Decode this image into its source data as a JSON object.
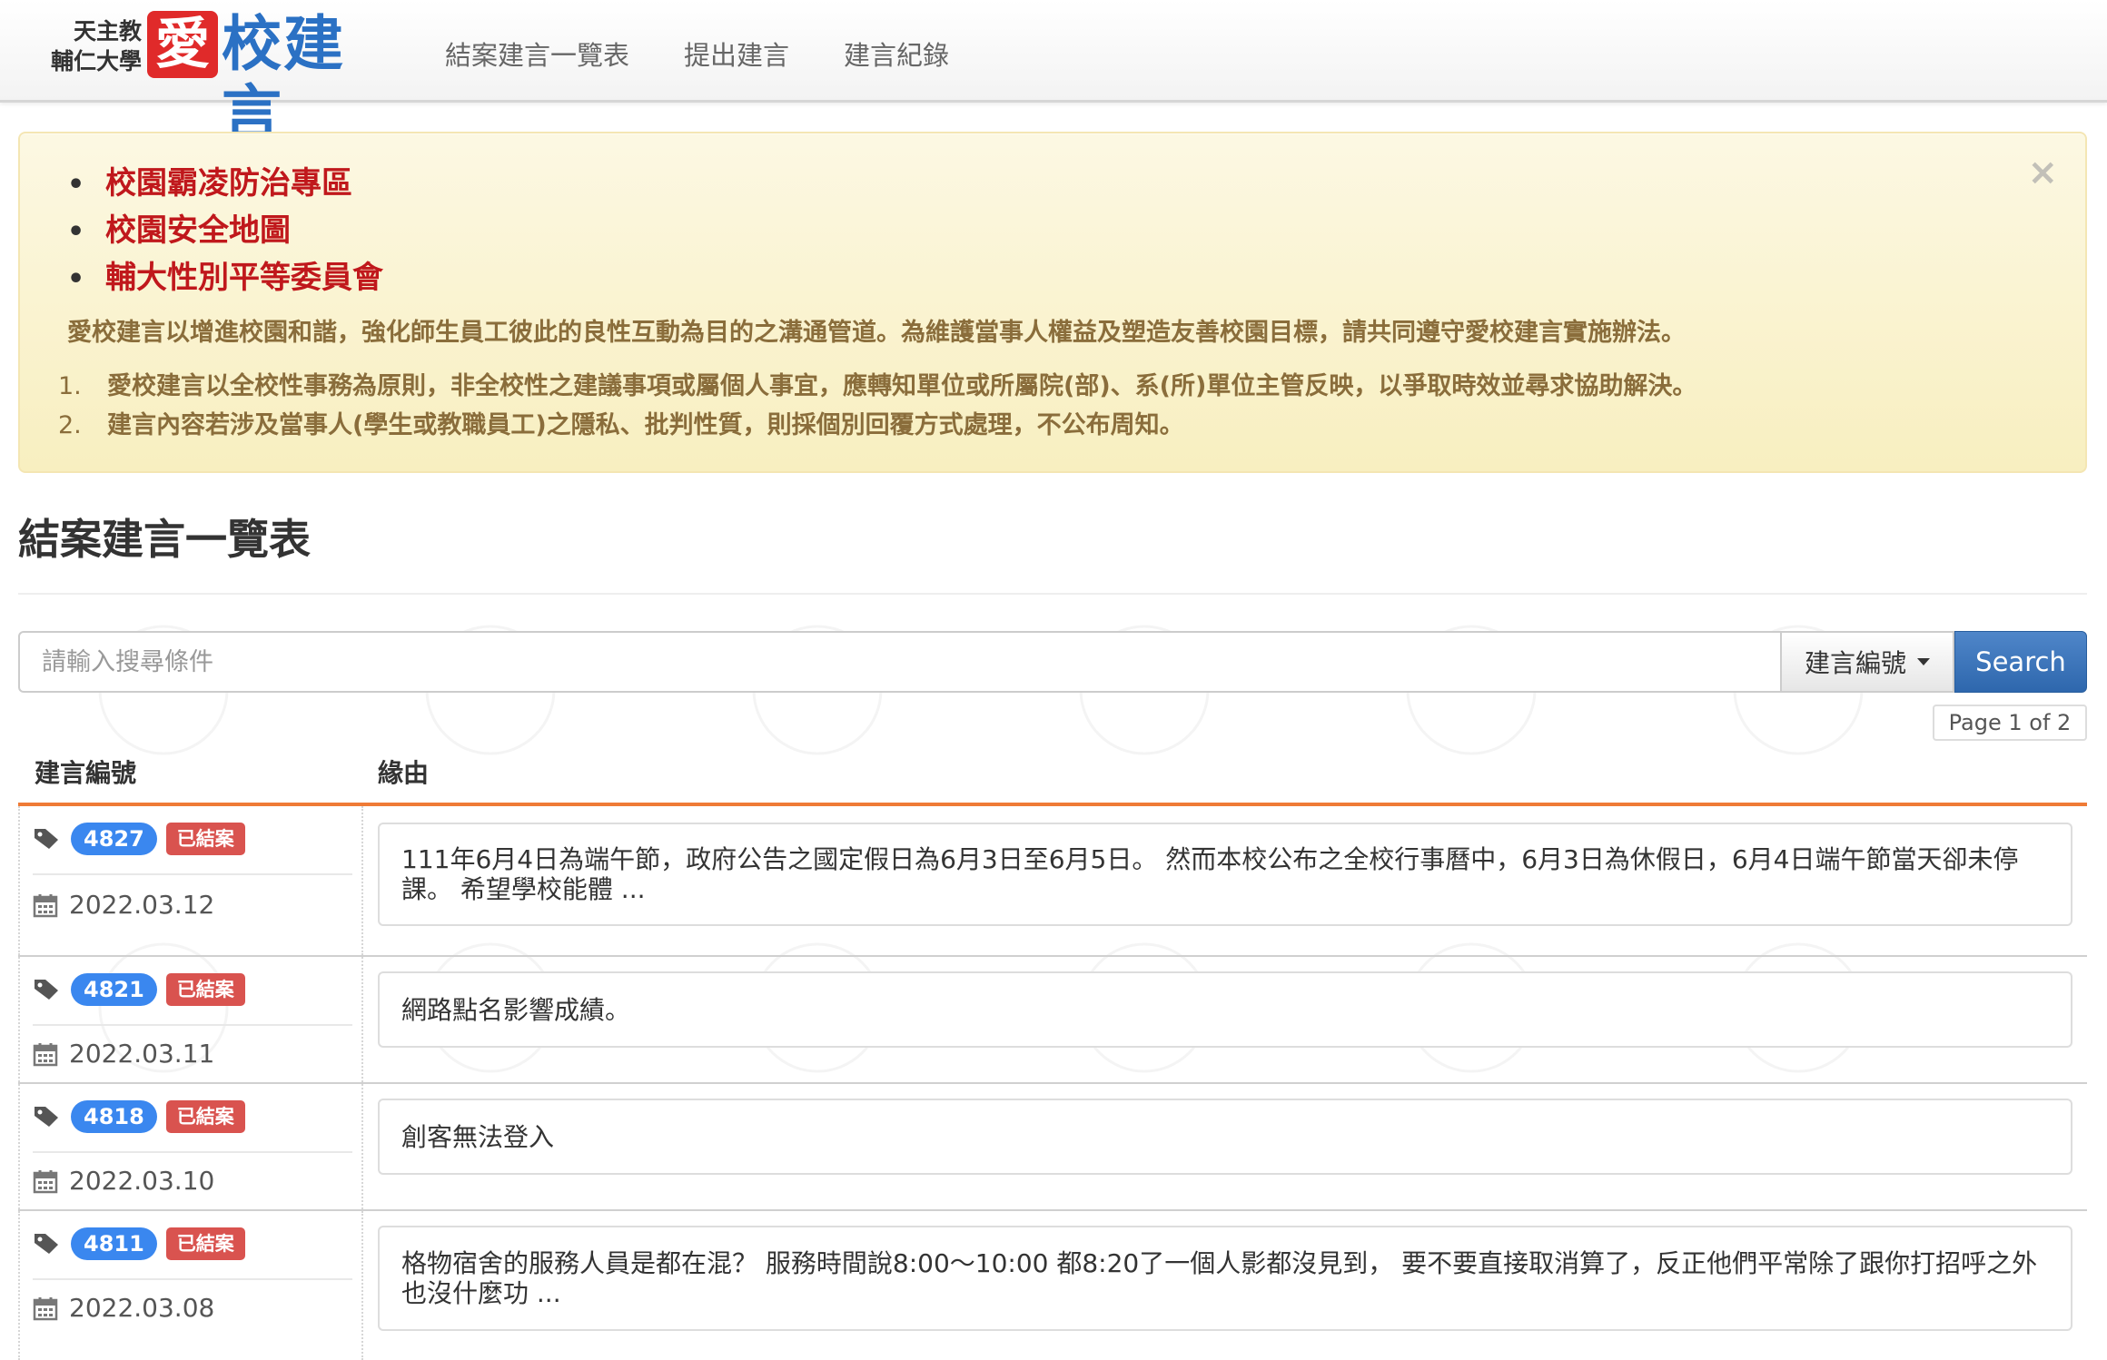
{
  "header": {
    "logo_small_line1": "天主教",
    "logo_small_line2": "輔仁大學",
    "logo_box": "愛",
    "logo_big": "校建言",
    "nav": [
      "結案建言一覽表",
      "提出建言",
      "建言紀錄"
    ]
  },
  "alert": {
    "close": "×",
    "links": [
      "校園霸凌防治專區",
      "校園安全地圖",
      "輔大性別平等委員會"
    ],
    "intro": "愛校建言以增進校園和諧，強化師生員工彼此的良性互動為目的之溝通管道。為維護當事人權益及塑造友善校園目標，請共同遵守愛校建言實施辦法。",
    "rules": [
      {
        "num": "1.",
        "text": "愛校建言以全校性事務為原則，非全校性之建議事項或屬個人事宜，應轉知單位或所屬院(部)、系(所)單位主管反映，以爭取時效並尋求協助解決。"
      },
      {
        "num": "2.",
        "text": "建言內容若涉及當事人(學生或教職員工)之隱私、批判性質，則採個別回覆方式處理，不公布周知。"
      }
    ]
  },
  "page_title": "結案建言一覽表",
  "search": {
    "placeholder": "請輸入搜尋條件",
    "field_select": "建言編號",
    "button": "Search"
  },
  "pagination": "Page 1 of 2",
  "table": {
    "col_id": "建言編號",
    "col_reason": "緣由",
    "rows": [
      {
        "id": "4827",
        "status": "已結案",
        "date": "2022.03.12",
        "reason": "111年6月4日為端午節，政府公告之國定假日為6月3日至6月5日。 然而本校公布之全校行事曆中，6月3日為休假日，6月4日端午節當天卻未停課。 希望學校能體 ..."
      },
      {
        "id": "4821",
        "status": "已結案",
        "date": "2022.03.11",
        "reason": "網路點名影響成績。"
      },
      {
        "id": "4818",
        "status": "已結案",
        "date": "2022.03.10",
        "reason": "創客無法登入"
      },
      {
        "id": "4811",
        "status": "已結案",
        "date": "2022.03.08",
        "reason": "格物宿舍的服務人員是都在混？ 服務時間說8:00～10:00 都8:20了一個人影都沒見到， 要不要直接取消算了，反正他們平常除了跟你打招呼之外也沒什麼功 ..."
      }
    ]
  },
  "colors": {
    "accent_blue": "#2b71c4",
    "alert_link_red": "#c0181c",
    "alert_text": "#8a6d3b",
    "badge_blue": "#3a87ef",
    "badge_red": "#d9534f",
    "table_rule_orange": "#ef7b36"
  },
  "icons": {
    "close": "close-icon",
    "tag": "tag-icon",
    "date": "calendar-icon",
    "dropdown": "caret-down-icon"
  }
}
